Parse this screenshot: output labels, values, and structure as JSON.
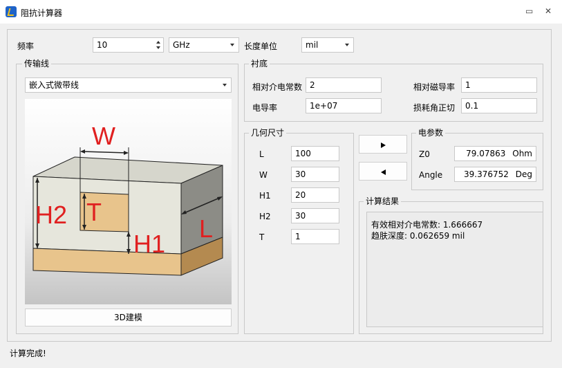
{
  "window": {
    "title": "阻抗计算器",
    "btn_help": "▭",
    "btn_close": "✕"
  },
  "frequency": {
    "label": "频率",
    "value": "10",
    "unit": "GHz"
  },
  "length_unit": {
    "label": "长度单位",
    "value": "mil"
  },
  "transmission_line": {
    "title": "传输线",
    "type": "嵌入式微带线",
    "model_button": "3D建模"
  },
  "diagram": {
    "label_w": "W",
    "label_t": "T",
    "label_h1": "H1",
    "label_h2": "H2",
    "label_l": "L"
  },
  "substrate": {
    "title": "衬底",
    "rel_permittivity_label": "相对介电常数",
    "rel_permittivity": "2",
    "rel_permeability_label": "相对磁导率",
    "rel_permeability": "1",
    "conductivity_label": "电导率",
    "conductivity": "1e+07",
    "loss_tangent_label": "损耗角正切",
    "loss_tangent": "0.1"
  },
  "geometry": {
    "title": "几何尺寸",
    "items": [
      {
        "label": "L",
        "value": "100"
      },
      {
        "label": "W",
        "value": "30"
      },
      {
        "label": "H1",
        "value": "20"
      },
      {
        "label": "H2",
        "value": "30"
      },
      {
        "label": "T",
        "value": "1"
      }
    ]
  },
  "electrical": {
    "title": "电参数",
    "z0_label": "Z0",
    "z0_value": "79.07863",
    "z0_unit": "Ohm",
    "angle_label": "Angle",
    "angle_value": "39.376752",
    "angle_unit": "Deg"
  },
  "results": {
    "title": "计算结果",
    "line1": "有效相对介电常数: 1.666667",
    "line2": "趋肤深度: 0.062659 mil"
  },
  "status": "计算完成!",
  "colors": {
    "accent_red": "#e02020",
    "substrate_top": "#e6e6dc",
    "conductor": "#e8c48c"
  }
}
